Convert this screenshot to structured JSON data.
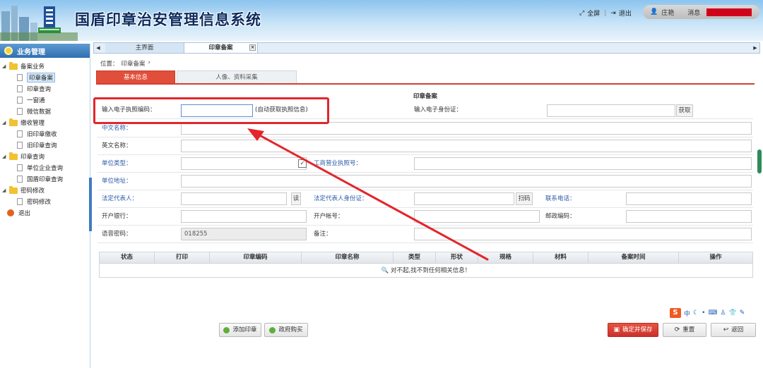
{
  "header": {
    "title": "国盾印章治安管理信息系统",
    "fullscreen": "全屏",
    "logout": "退出",
    "username": "庄艳",
    "messages": "消息"
  },
  "sidebar": {
    "title": "业务管理",
    "groups": [
      {
        "label": "备案业务",
        "items": [
          "印章备案",
          "印章查询",
          "一窗通",
          "微信数据"
        ]
      },
      {
        "label": "缴收管理",
        "items": [
          "旧印章缴收",
          "旧印章查询"
        ]
      },
      {
        "label": "印章查询",
        "items": [
          "单位企业查询",
          "国盾印章查询"
        ]
      },
      {
        "label": "密码修改",
        "items": [
          "密码修改"
        ]
      }
    ],
    "exit": "退出"
  },
  "tabs": {
    "home": "主界面",
    "current": "印章备案",
    "close": "×"
  },
  "breadcrumb": {
    "prefix": "位置：",
    "page": "印章备案",
    "sep": "›"
  },
  "subtabs": {
    "basic": "基本信息",
    "capture": "人像、资料采集"
  },
  "form": {
    "title": "印章备案",
    "license_label": "输入电子执照编码：",
    "license_hint": "(自动获取执照信息)",
    "idcard_label": "输入电子身份证：",
    "fetch_btn": "获取",
    "cn_name": "中文名称：",
    "en_name": "英文名称：",
    "unit_type": "单位类型：",
    "biz_license": "工商营业执照号：",
    "unit_addr": "单位地址：",
    "legal_rep": "法定代表人：",
    "read_btn": "读",
    "legal_id": "法定代表人身份证：",
    "scan_btn": "扫码",
    "phone": "联系电话：",
    "bank": "开户银行：",
    "account": "开户帐号：",
    "postcode": "邮政编码：",
    "voice_pwd": "语音密码：",
    "voice_pwd_value": "018255",
    "remark": "备注："
  },
  "grid": {
    "columns": [
      "状态",
      "打印",
      "印章编码",
      "印章名称",
      "类型",
      "形状",
      "规格",
      "材料",
      "备案时间",
      "操作"
    ],
    "empty": "对不起,找不到任何相关信息！"
  },
  "ime": {
    "logo": "S",
    "lang": "中"
  },
  "buttons": {
    "add_seal": "添加印章",
    "gov_buy": "政府购买",
    "confirm_save": "确定并保存",
    "reset": "重置",
    "back": "返回"
  },
  "colors": {
    "accent_red": "#e14f3a",
    "annotation_red": "#e3262b",
    "header_sky": "#8cc4ee",
    "sidebar_blue": "#2f6fb0"
  }
}
